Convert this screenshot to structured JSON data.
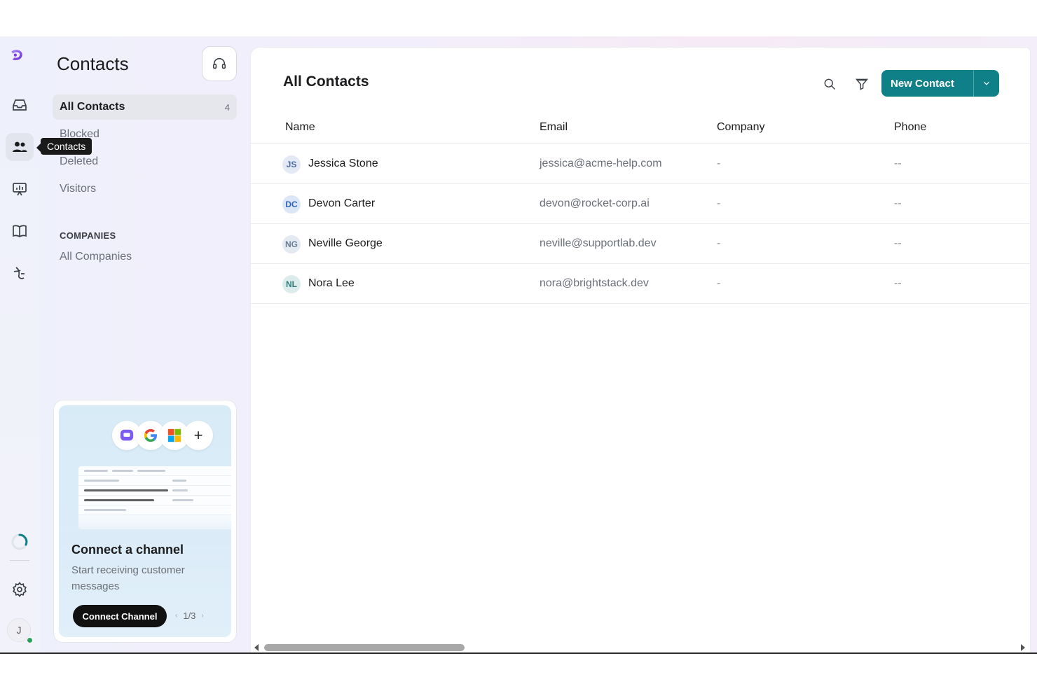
{
  "rail": {
    "tooltip": "Contacts",
    "avatar_initial": "J",
    "icons": [
      "logo-icon",
      "inbox-icon",
      "contacts-icon",
      "reports-icon",
      "knowledge-base-icon",
      "ai-agent-icon",
      "loading-ring-icon",
      "settings-icon"
    ]
  },
  "sidebar": {
    "title": "Contacts",
    "items": [
      {
        "label": "All Contacts",
        "count": "4"
      },
      {
        "label": "Blocked"
      },
      {
        "label": "Deleted"
      },
      {
        "label": "Visitors"
      }
    ],
    "companies_section": "COMPANIES",
    "companies_items": [
      {
        "label": "All Companies"
      }
    ]
  },
  "promo": {
    "title": "Connect a channel",
    "subtitle": "Start receiving customer messages",
    "button": "Connect Channel",
    "pager": "1/3",
    "icons": [
      "chat-icon",
      "google-icon",
      "microsoft-icon",
      "plus-icon"
    ]
  },
  "main": {
    "title": "All Contacts",
    "new_contact_label": "New Contact",
    "columns": [
      "Name",
      "Email",
      "Company",
      "Phone"
    ],
    "rows": [
      {
        "initials": "JS",
        "name": "Jessica Stone",
        "email": "jessica@acme-help.com",
        "company": "-",
        "phone": "--"
      },
      {
        "initials": "DC",
        "name": "Devon Carter",
        "email": "devon@rocket-corp.ai",
        "company": "-",
        "phone": "--"
      },
      {
        "initials": "NG",
        "name": "Neville George",
        "email": "neville@supportlab.dev",
        "company": "-",
        "phone": "--"
      },
      {
        "initials": "NL",
        "name": "Nora Lee",
        "email": "nora@brightstack.dev",
        "company": "-",
        "phone": "--"
      }
    ]
  },
  "colors": {
    "accent": "#0f7f88",
    "avatar_bg": [
      "#e3eaf6",
      "#dbe7f7",
      "#e3eaf2",
      "#dcebeb"
    ],
    "avatar_fg": [
      "#4b6aa5",
      "#2f62b8",
      "#6b7d94",
      "#2e7d7a"
    ]
  }
}
